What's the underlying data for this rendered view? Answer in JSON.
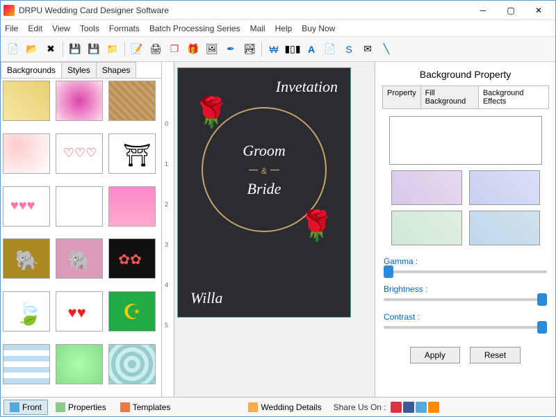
{
  "window": {
    "title": "DRPU Wedding Card Designer Software"
  },
  "menu": [
    "File",
    "Edit",
    "View",
    "Tools",
    "Formats",
    "Batch Processing Series",
    "Mail",
    "Help",
    "Buy Now"
  ],
  "left_tabs": [
    "Backgrounds",
    "Styles",
    "Shapes"
  ],
  "card": {
    "invitation": "Invetation",
    "groom": "Groom",
    "amp": "&",
    "bride": "Bride",
    "willa": "Willa"
  },
  "right": {
    "title": "Background Property",
    "tabs": [
      "Property",
      "Fill Background",
      "Background Effects"
    ],
    "sliders": {
      "gamma": "Gamma :",
      "brightness": "Brightness :",
      "contrast": "Contrast :"
    },
    "apply": "Apply",
    "reset": "Reset"
  },
  "bottom": {
    "front": "Front",
    "properties": "Properties",
    "templates": "Templates",
    "wedding": "Wedding Details",
    "share": "Share Us On :"
  }
}
